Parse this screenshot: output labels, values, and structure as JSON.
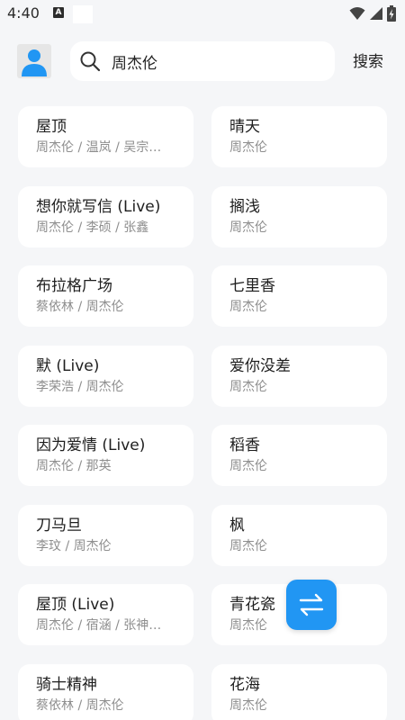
{
  "status_bar": {
    "time": "4:40",
    "notification_badge": "A",
    "icons": [
      "wifi-icon",
      "signal-icon",
      "battery-charging-icon"
    ]
  },
  "header": {
    "search_value": "周杰伦",
    "search_button": "搜索",
    "avatar_icon": "user-avatar-icon"
  },
  "songs": [
    {
      "title": "屋顶",
      "artist": "周杰伦 / 温岚 / 吴宗…"
    },
    {
      "title": "晴天",
      "artist": "周杰伦"
    },
    {
      "title": "想你就写信 (Live)",
      "artist": "周杰伦 / 李硕 / 张鑫"
    },
    {
      "title": "搁浅",
      "artist": "周杰伦"
    },
    {
      "title": "布拉格广场",
      "artist": "蔡依林 / 周杰伦"
    },
    {
      "title": "七里香",
      "artist": "周杰伦"
    },
    {
      "title": "默 (Live)",
      "artist": "李荣浩 / 周杰伦"
    },
    {
      "title": "爱你没差",
      "artist": "周杰伦"
    },
    {
      "title": "因为爱情 (Live)",
      "artist": "周杰伦 / 那英"
    },
    {
      "title": "稻香",
      "artist": "周杰伦"
    },
    {
      "title": "刀马旦",
      "artist": "李玟 / 周杰伦"
    },
    {
      "title": "枫",
      "artist": "周杰伦"
    },
    {
      "title": "屋顶 (Live)",
      "artist": "周杰伦 / 宿涵 / 张神…"
    },
    {
      "title": "青花瓷",
      "artist": "周杰伦"
    },
    {
      "title": "骑士精神",
      "artist": "蔡依林 / 周杰伦"
    },
    {
      "title": "花海",
      "artist": "周杰伦"
    }
  ],
  "fab": {
    "icon": "swap-arrows-icon"
  },
  "colors": {
    "accent": "#2196f3",
    "background": "#f5f6f8",
    "card": "#ffffff",
    "title_text": "#1e1e1e",
    "secondary_text": "#8e8e8e"
  }
}
